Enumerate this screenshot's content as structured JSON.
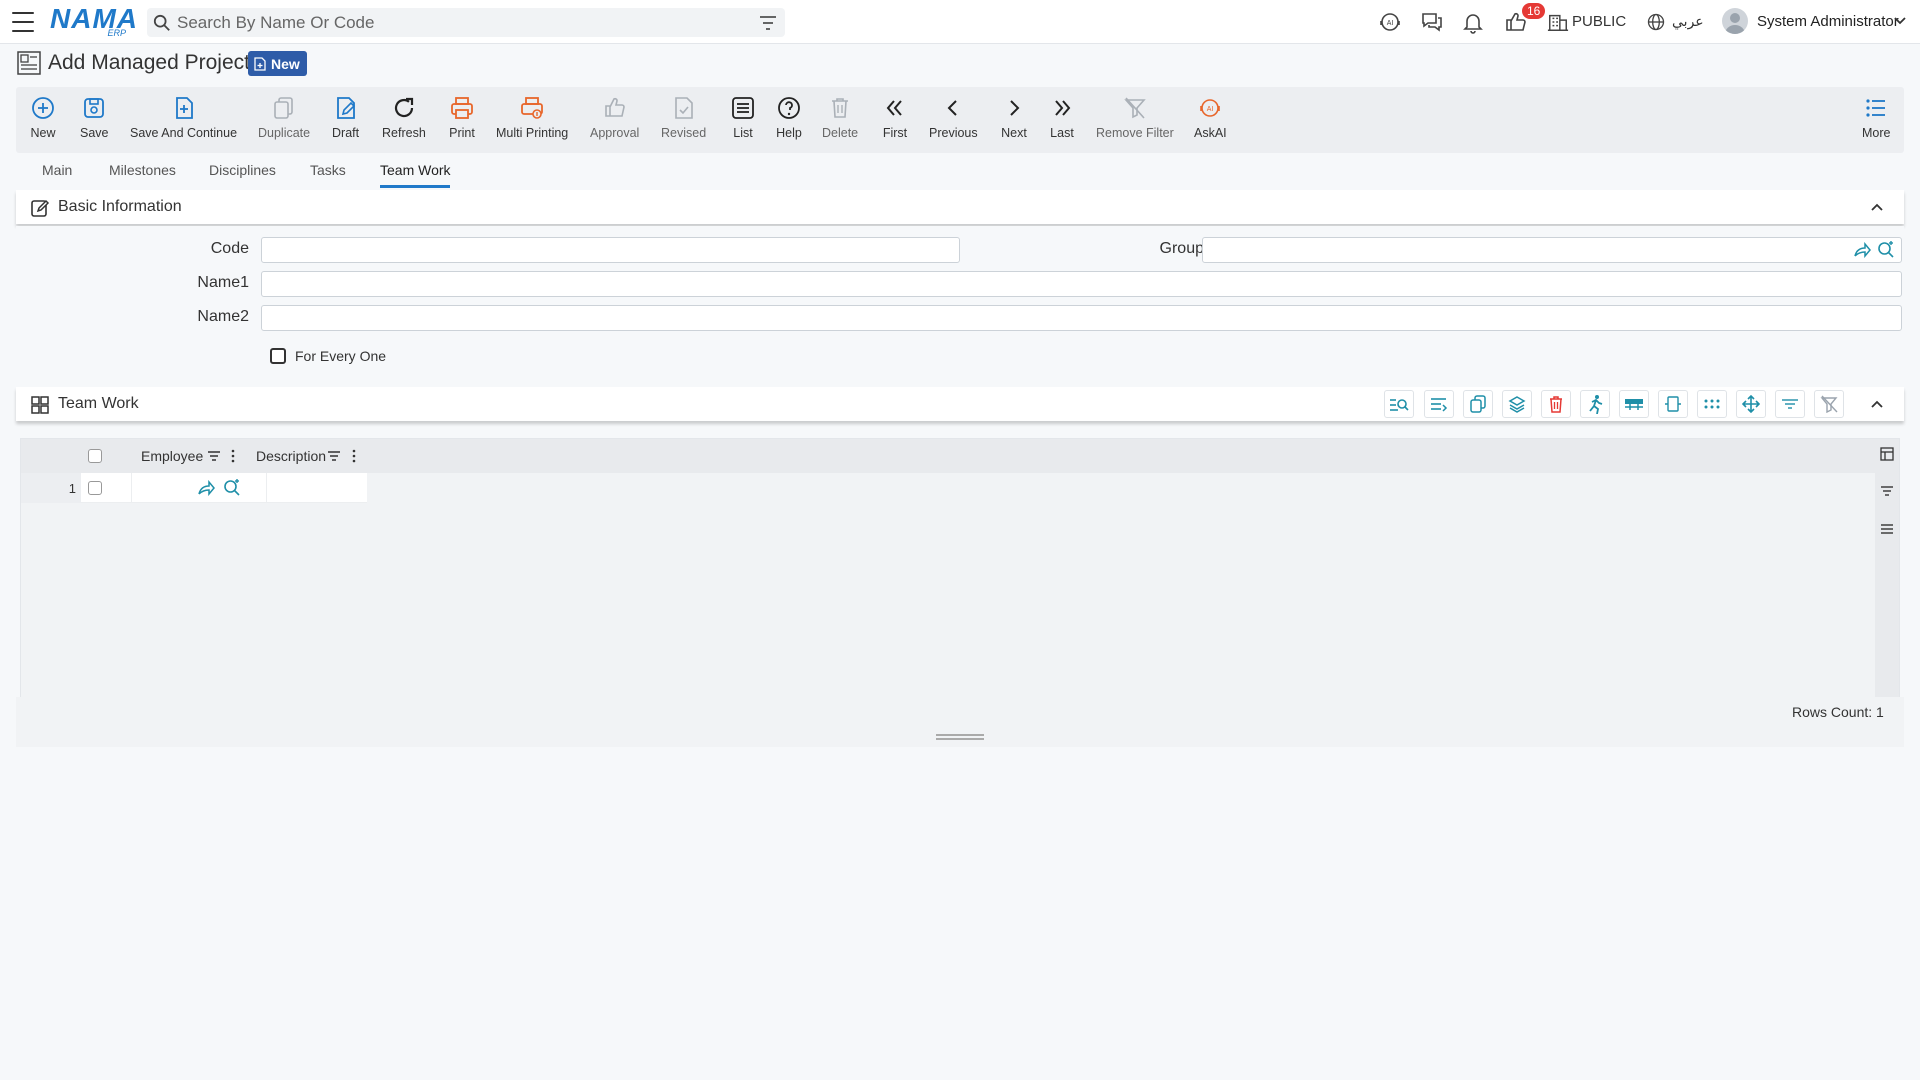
{
  "topbar": {
    "logo_main": "NAMA",
    "logo_sub": "ERP",
    "search_placeholder": "Search By Name Or Code",
    "notification_count": "16",
    "branch": "PUBLIC",
    "language": "عربي",
    "user_name": "System Administrator"
  },
  "page": {
    "title": "Add Managed Project",
    "status_badge": "New"
  },
  "toolbar": {
    "new": "New",
    "save": "Save",
    "save_continue": "Save And Continue",
    "duplicate": "Duplicate",
    "draft": "Draft",
    "refresh": "Refresh",
    "print": "Print",
    "multi_printing": "Multi Printing",
    "approval": "Approval",
    "revised": "Revised",
    "list": "List",
    "help": "Help",
    "delete": "Delete",
    "first": "First",
    "previous": "Previous",
    "next": "Next",
    "last": "Last",
    "remove_filter": "Remove Filter",
    "askai": "AskAI",
    "more": "More"
  },
  "tabs": [
    "Main",
    "Milestones",
    "Disciplines",
    "Tasks",
    "Team Work"
  ],
  "active_tab": "Team Work",
  "basic_info": {
    "title": "Basic Information",
    "code_label": "Code",
    "code_value": "",
    "group_label": "Group",
    "group_value": "",
    "name1_label": "Name1",
    "name1_value": "",
    "name2_label": "Name2",
    "name2_value": "",
    "for_every_one_label": "For Every One",
    "for_every_one_checked": false
  },
  "team_work": {
    "title": "Team Work",
    "columns": [
      "Employee",
      "Description"
    ],
    "rows": [
      {
        "num": "1",
        "employee": "",
        "description": ""
      }
    ],
    "rows_count_label": "Rows Count: 1"
  },
  "colors": {
    "accent": "#1f79c9",
    "badge_bg": "#2e5ca8",
    "print_orange": "#e8662b",
    "teal": "#1f8fa8",
    "danger": "#e53935"
  }
}
